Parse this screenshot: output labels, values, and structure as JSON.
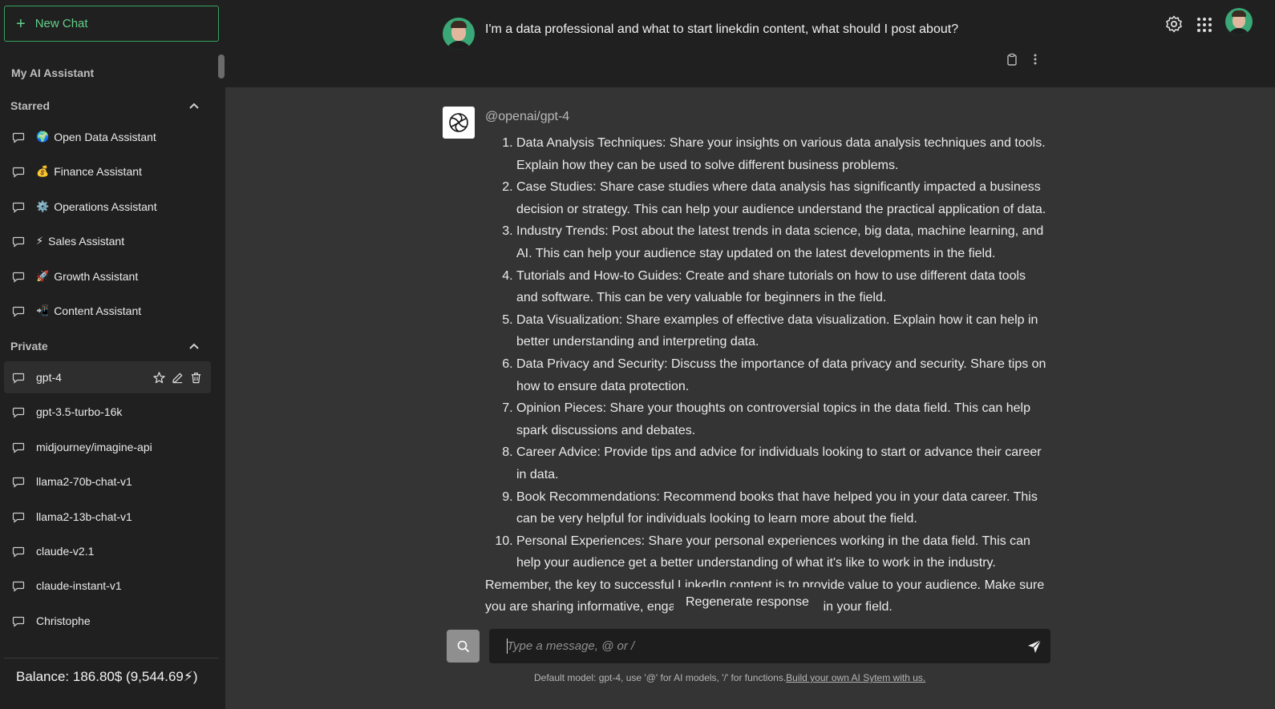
{
  "sidebar": {
    "new_chat_label": "New Chat",
    "assistant_title": "My AI Assistant",
    "starred_heading": "Starred",
    "starred_items": [
      {
        "emoji": "🌍",
        "label": "Open Data Assistant"
      },
      {
        "emoji": "💰",
        "label": "Finance Assistant"
      },
      {
        "emoji": "⚙️",
        "label": "Operations Assistant"
      },
      {
        "emoji": "⚡",
        "label": "Sales Assistant"
      },
      {
        "emoji": "🚀",
        "label": "Growth Assistant"
      },
      {
        "emoji": "📲",
        "label": "Content Assistant"
      }
    ],
    "private_heading": "Private",
    "private_items": [
      {
        "label": "gpt-4",
        "active": true
      },
      {
        "label": "gpt-3.5-turbo-16k"
      },
      {
        "label": "midjourney/imagine-api"
      },
      {
        "label": "llama2-70b-chat-v1"
      },
      {
        "label": "llama2-13b-chat-v1"
      },
      {
        "label": "claude-v2.1"
      },
      {
        "label": "claude-instant-v1"
      },
      {
        "label": "Christophe"
      }
    ],
    "balance": "Balance: 186.80$ (9,544.69⚡)"
  },
  "conversation": {
    "user_message": "I'm a data professional and what to start linekdin content, what should I post about?",
    "bot_name": "@openai/gpt-4",
    "answer_items": [
      "Data Analysis Techniques: Share your insights on various data analysis techniques and tools. Explain how they can be used to solve different business problems.",
      "Case Studies: Share case studies where data analysis has significantly impacted a business decision or strategy. This can help your audience understand the practical application of data.",
      "Industry Trends: Post about the latest trends in data science, big data, machine learning, and AI. This can help your audience stay updated on the latest developments in the field.",
      "Tutorials and How-to Guides: Create and share tutorials on how to use different data tools and software. This can be very valuable for beginners in the field.",
      "Data Visualization: Share examples of effective data visualization. Explain how it can help in better understanding and interpreting data.",
      "Data Privacy and Security: Discuss the importance of data privacy and security. Share tips on how to ensure data protection.",
      "Opinion Pieces: Share your thoughts on controversial topics in the data field. This can help spark discussions and debates.",
      "Career Advice: Provide tips and advice for individuals looking to start or advance their career in data.",
      "Book Recommendations: Recommend books that have helped you in your data career. This can be very helpful for individuals looking to learn more about the field.",
      "Personal Experiences: Share your personal experiences working in the data field. This can help your audience get a better understanding of what it's like to work in the industry."
    ],
    "answer_closing": "Remember, the key to successful LinkedIn content is to provide value to your audience. Make sure you are sharing informative, engaging and relevant content in your field."
  },
  "regenerate_label": "Regenerate response",
  "composer": {
    "placeholder": "Type a message, @ or /"
  },
  "footer": {
    "note": "Default model: gpt-4, use '@' for AI models, '/' for functions.",
    "link": "Build your own AI Sytem with us."
  },
  "colors": {
    "accent": "#63d08a",
    "sidebar_bg": "#202020",
    "main_bg": "#343434"
  }
}
